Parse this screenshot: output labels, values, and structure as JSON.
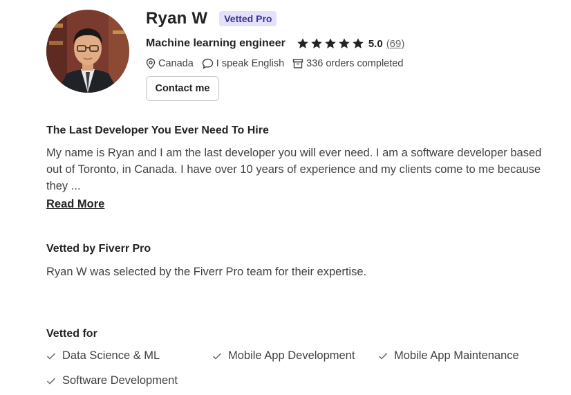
{
  "profile": {
    "name": "Ryan W",
    "badge": "Vetted Pro",
    "headline": "Machine learning engineer",
    "rating": "5.0",
    "reviews": "(69)",
    "stars": 5,
    "location": "Canada",
    "language": "I speak English",
    "orders": "336 orders completed",
    "contact_label": "Contact me"
  },
  "about": {
    "title": "The Last Developer You Ever Need To Hire",
    "body": "My name is Ryan and I am the last developer you will ever need. I am a software developer based out of Toronto, in Canada. I have over 10 years of experience and my clients come to me because they ...",
    "read_more": "Read More"
  },
  "vetted_by": {
    "title": "Vetted by Fiverr Pro",
    "description": "Ryan W was selected by the Fiverr Pro team for their expertise."
  },
  "vetted_for": {
    "title": "Vetted for",
    "skills": [
      "Data Science & ML",
      "Mobile App Development",
      "Mobile App Maintenance",
      "Software Development"
    ]
  },
  "colors": {
    "badge_bg": "#e3e1fb",
    "badge_text": "#3b2f99",
    "text_dark": "#222325",
    "text_body": "#404145"
  },
  "icons": {
    "location": "map-pin-icon",
    "language": "speech-bubble-icon",
    "orders": "box-icon",
    "skill": "check-icon",
    "rating": "star-icon"
  }
}
